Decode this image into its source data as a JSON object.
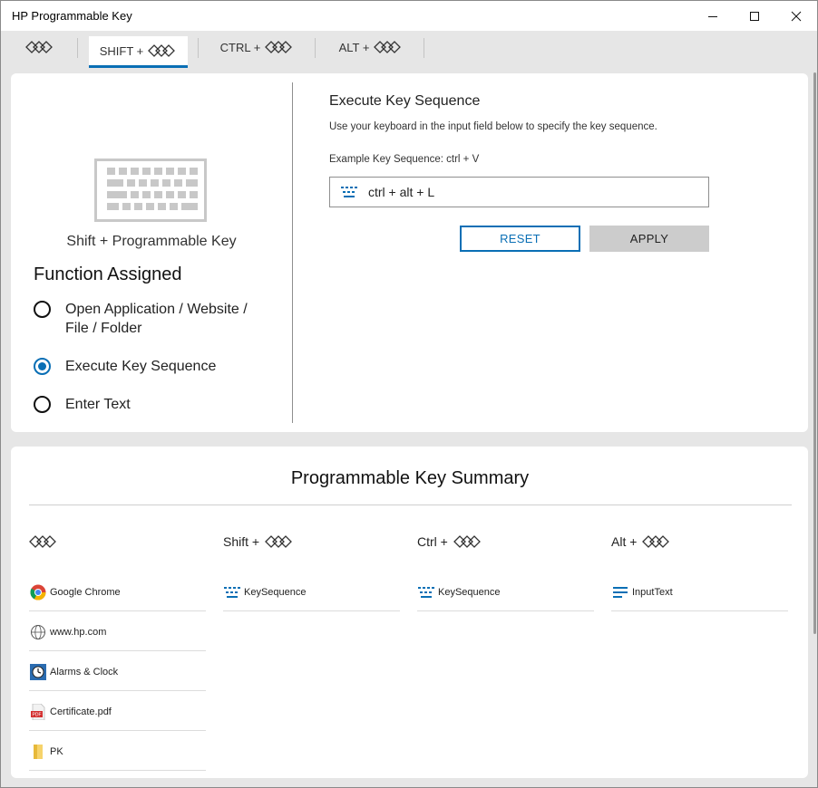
{
  "window": {
    "title": "HP Programmable Key"
  },
  "tabs": [
    {
      "label": ""
    },
    {
      "label": "SHIFT +"
    },
    {
      "label": "CTRL +"
    },
    {
      "label": "ALT +"
    }
  ],
  "left_panel": {
    "key_label": "Shift + Programmable Key",
    "function_title": "Function Assigned",
    "options": [
      {
        "label": "Open Application / Website / File / Folder",
        "selected": false
      },
      {
        "label": "Execute Key Sequence",
        "selected": true
      },
      {
        "label": "Enter Text",
        "selected": false
      }
    ]
  },
  "right_panel": {
    "title": "Execute Key Sequence",
    "description": "Use your keyboard in the input field below to specify the key sequence.",
    "example": "Example Key Sequence: ctrl + V",
    "input_value": "ctrl + alt + L",
    "reset_label": "RESET",
    "apply_label": "APPLY"
  },
  "summary": {
    "title": "Programmable Key Summary",
    "columns": [
      {
        "header": "",
        "items": [
          {
            "icon": "chrome-icon",
            "label": "Google Chrome"
          },
          {
            "icon": "web-globe-icon",
            "label": "www.hp.com"
          },
          {
            "icon": "alarm-clock-icon",
            "label": "Alarms & Clock"
          },
          {
            "icon": "pdf-file-icon",
            "label": "Certificate.pdf"
          },
          {
            "icon": "folder-icon",
            "label": "PK"
          }
        ]
      },
      {
        "header": "Shift +",
        "items": [
          {
            "icon": "keyboard-icon",
            "label": "KeySequence"
          }
        ]
      },
      {
        "header": "Ctrl +",
        "items": [
          {
            "icon": "keyboard-icon",
            "label": "KeySequence"
          }
        ]
      },
      {
        "header": "Alt +",
        "items": [
          {
            "icon": "text-lines-icon",
            "label": "InputText"
          }
        ]
      }
    ]
  },
  "colors": {
    "accent": "#0a6fb5",
    "background": "#e6e6e6",
    "card": "#ffffff",
    "apply_button": "#cccccc"
  }
}
